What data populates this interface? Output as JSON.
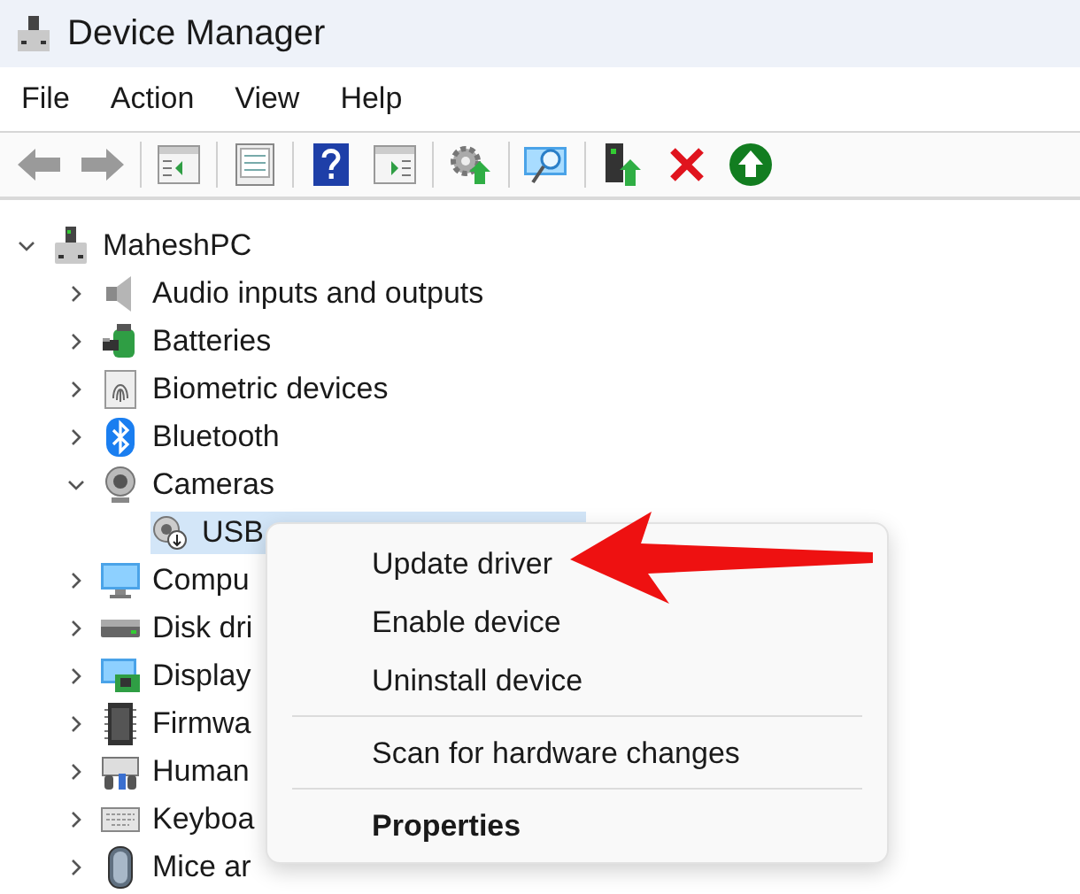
{
  "window": {
    "title": "Device Manager"
  },
  "menu_bar": [
    {
      "label": "File"
    },
    {
      "label": "Action"
    },
    {
      "label": "View"
    },
    {
      "label": "Help"
    }
  ],
  "tree": {
    "label": "MaheshPC",
    "expanded": true,
    "selected": false,
    "children": [
      {
        "label": "Audio inputs and outputs",
        "expanded": false,
        "selected": false
      },
      {
        "label": "Batteries",
        "expanded": false,
        "selected": false
      },
      {
        "label": "Biometric devices",
        "expanded": false,
        "selected": false
      },
      {
        "label": "Bluetooth",
        "expanded": false,
        "selected": false
      },
      {
        "label": "Cameras",
        "expanded": true,
        "selected": false,
        "children": [
          {
            "label": "USB",
            "selected": true
          }
        ]
      },
      {
        "label": "Compu",
        "expanded": false,
        "selected": false
      },
      {
        "label": "Disk dri",
        "expanded": false,
        "selected": false
      },
      {
        "label": "Display",
        "expanded": false,
        "selected": false
      },
      {
        "label": "Firmwa",
        "expanded": false,
        "selected": false
      },
      {
        "label": "Human",
        "expanded": false,
        "selected": false
      },
      {
        "label": "Keyboa",
        "expanded": false,
        "selected": false
      },
      {
        "label": "Mice ar",
        "expanded": false,
        "selected": false
      }
    ]
  },
  "context_menu": [
    {
      "kind": "command",
      "label": "Update driver",
      "default": false
    },
    {
      "kind": "command",
      "label": "Enable device",
      "default": false
    },
    {
      "kind": "command",
      "label": "Uninstall device",
      "default": false
    },
    {
      "kind": "separator"
    },
    {
      "kind": "command",
      "label": "Scan for hardware changes",
      "default": false
    },
    {
      "kind": "separator"
    },
    {
      "kind": "command",
      "label": "Properties",
      "default": true
    }
  ]
}
